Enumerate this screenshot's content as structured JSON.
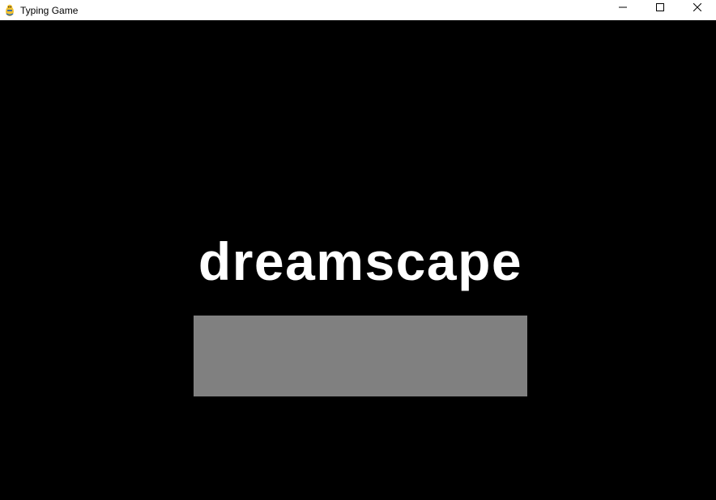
{
  "window": {
    "title": "Typing Game",
    "app_icon": "pygame-snake-icon",
    "controls": {
      "minimize_icon": "minimize-icon",
      "maximize_icon": "maximize-icon",
      "close_icon": "close-icon"
    }
  },
  "game": {
    "target_word": "dreamscape",
    "typed_text": "",
    "colors": {
      "background": "#000000",
      "word": "#ffffff",
      "input_box": "#808080"
    }
  }
}
